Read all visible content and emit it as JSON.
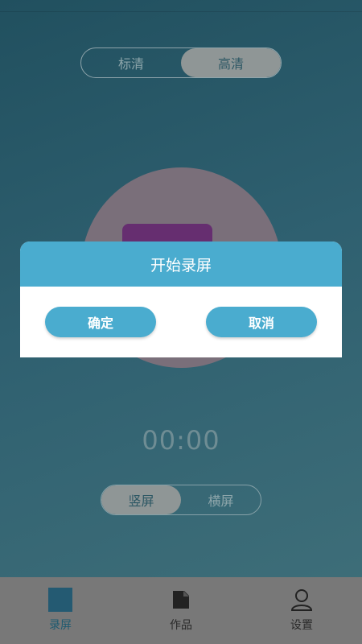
{
  "quality": {
    "options": [
      "标清",
      "高清"
    ],
    "selected": "高清"
  },
  "timer": "00:00",
  "orientation": {
    "options": [
      "竖屏",
      "横屏"
    ],
    "selected": "竖屏"
  },
  "nav": {
    "items": [
      {
        "label": "录屏",
        "icon": "record-square-icon",
        "active": true
      },
      {
        "label": "作品",
        "icon": "works-file-icon",
        "active": false
      },
      {
        "label": "设置",
        "icon": "person-icon",
        "active": false
      }
    ]
  },
  "dialog": {
    "title": "开始录屏",
    "confirm_label": "确定",
    "cancel_label": "取消"
  },
  "colors": {
    "accent": "#4aaccf",
    "record_inner": "#662e70",
    "nav_active": "#245a72"
  }
}
